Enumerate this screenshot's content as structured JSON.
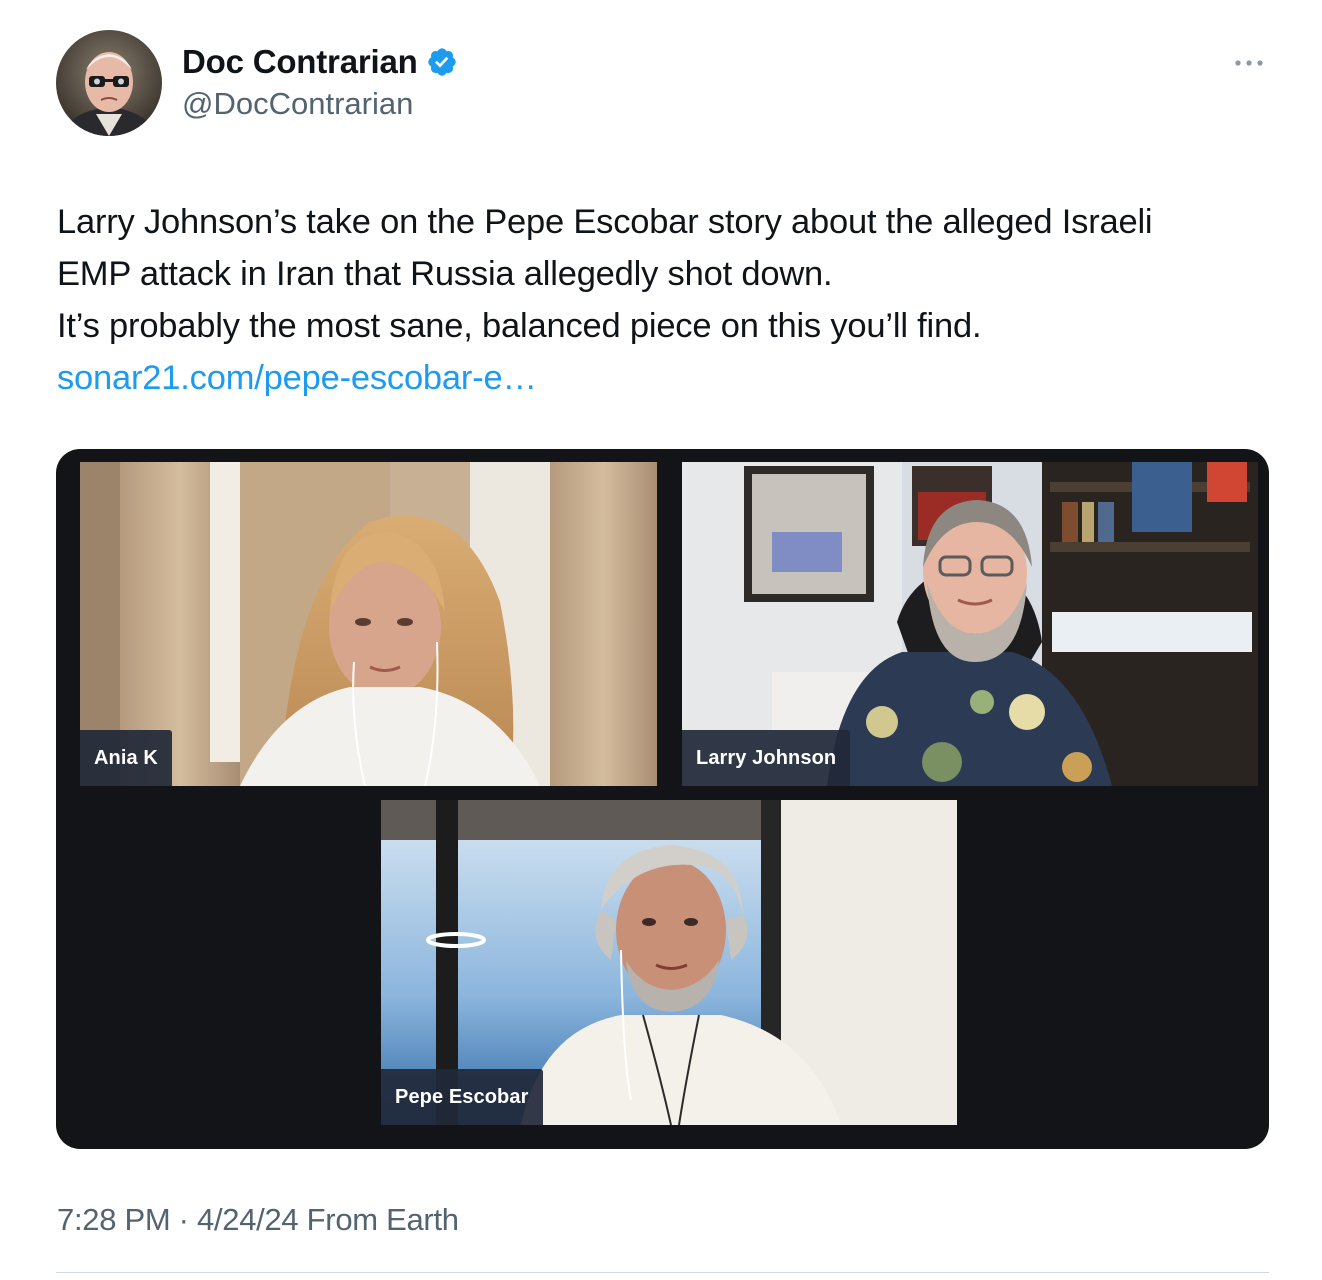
{
  "author": {
    "display_name": "Doc Contrarian",
    "handle": "@DocContrarian",
    "verified": true,
    "verified_color": "#1d9bf0"
  },
  "tweet": {
    "lines": [
      "Larry Johnson’s take on the Pepe Escobar story about the alleged Israeli",
      "EMP attack in Iran that Russia allegedly shot down.",
      "It’s probably the most sane, balanced piece on this you’ll find."
    ],
    "link_text": "sonar21.com/pepe-escobar-e…",
    "link_color": "#1d9bf0"
  },
  "media": {
    "participants": [
      {
        "name": "Ania K"
      },
      {
        "name": "Larry Johnson"
      },
      {
        "name": "Pepe Escobar"
      }
    ]
  },
  "footer": {
    "time": "7:28 PM",
    "separator": " · ",
    "date": "4/24/24",
    "source": " From Earth"
  },
  "icons": {
    "more": "more-horizontal-icon",
    "verified": "verified-badge-icon"
  }
}
